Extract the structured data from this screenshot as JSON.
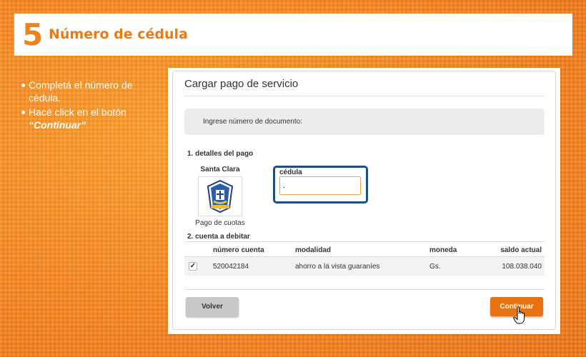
{
  "header": {
    "step_number": "5",
    "title": "Número de cédula"
  },
  "instructions": {
    "item1": "Completá el número de cédula.",
    "item2_prefix": "Hacé click en el botón",
    "item2_strong": "“Continuar”"
  },
  "panel": {
    "title": "Cargar pago de servicio",
    "document_label": "Ingrese número de documento:",
    "section1_label": "1. detalles del pago",
    "service_name": "Santa Clara",
    "service_caption": "Pago de cuotas",
    "service_icon": "school-crest-icon",
    "cedula_label": "cédula",
    "cedula_value": ".",
    "section2_label": "2. cuenta a debitar",
    "table": {
      "headers": [
        "número cuenta",
        "modalidad",
        "moneda",
        "saldo actual"
      ],
      "rows": [
        {
          "checked": true,
          "cells": [
            "520042184",
            "ahorro a la vista guaraníes",
            "Gs.",
            "108.038.040"
          ]
        }
      ]
    },
    "back_label": "Volver",
    "continue_label": "Continuar"
  },
  "colors": {
    "accent": "#ee7a14",
    "focus_border": "#1f4f7e",
    "button_primary": "#e8720f"
  }
}
